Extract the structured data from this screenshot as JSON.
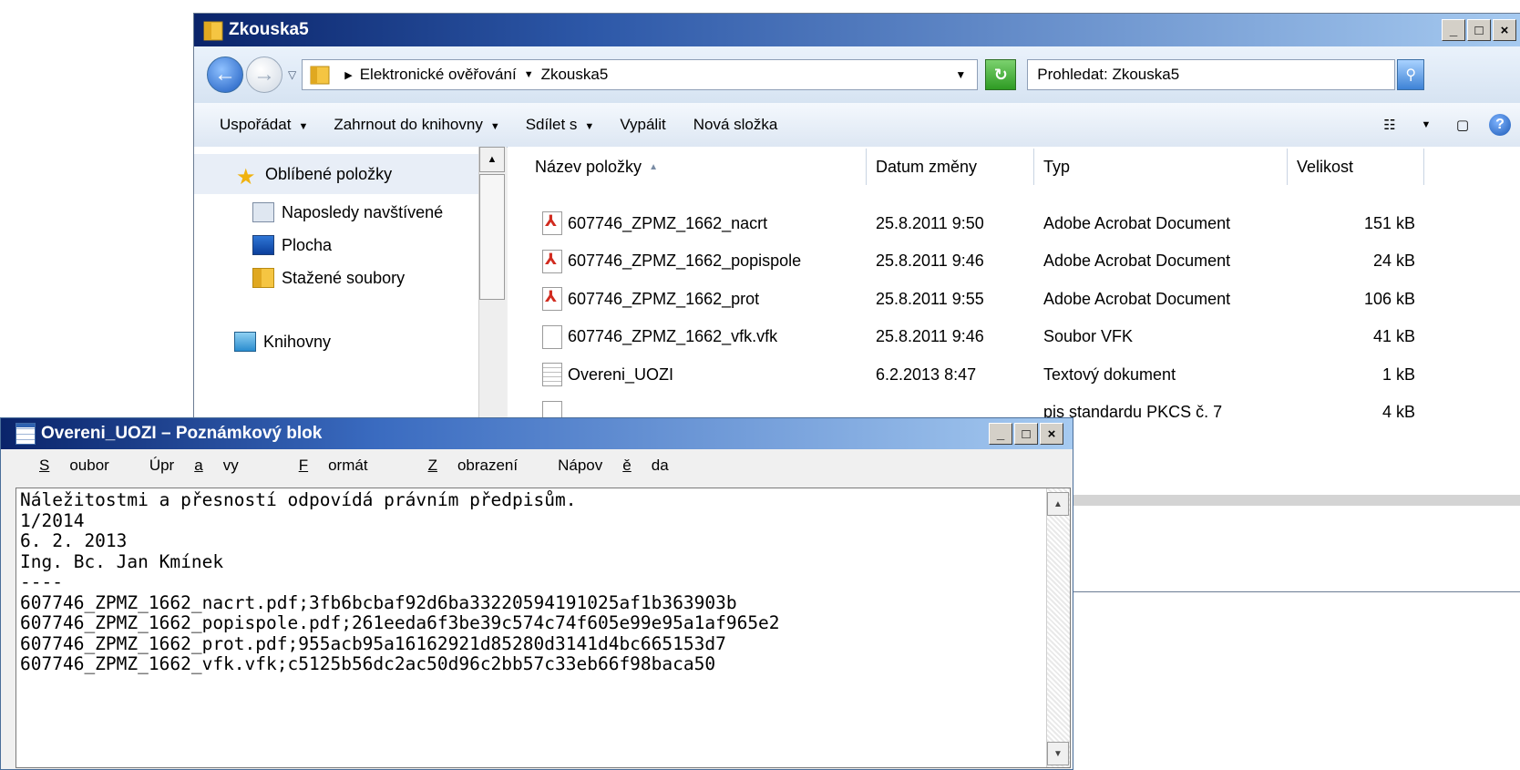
{
  "explorer": {
    "title": "Zkouska5",
    "breadcrumb": [
      "Elektronické ověřování",
      "Zkouska5"
    ],
    "search_placeholder": "Prohledat: Zkouska5",
    "toolbar": {
      "organize": "Uspořádat",
      "include_in_library": "Zahrnout do knihovny",
      "share": "Sdílet s",
      "burn": "Vypálit",
      "new_folder": "Nová složka"
    },
    "nav": {
      "favorites": "Oblíbené položky",
      "recent": "Naposledy navštívené",
      "desktop": "Plocha",
      "downloads": "Stažené soubory",
      "libraries": "Knihovny"
    },
    "columns": {
      "name": "Název položky",
      "date": "Datum změny",
      "type": "Typ",
      "size": "Velikost"
    },
    "files": [
      {
        "name": "607746_ZPMZ_1662_nacrt",
        "date": "25.8.2011 9:50",
        "type": "Adobe Acrobat Document",
        "size": "151 kB",
        "icon": "pdf"
      },
      {
        "name": "607746_ZPMZ_1662_popispole",
        "date": "25.8.2011 9:46",
        "type": "Adobe Acrobat Document",
        "size": "24 kB",
        "icon": "pdf"
      },
      {
        "name": "607746_ZPMZ_1662_prot",
        "date": "25.8.2011 9:55",
        "type": "Adobe Acrobat Document",
        "size": "106 kB",
        "icon": "pdf"
      },
      {
        "name": "607746_ZPMZ_1662_vfk.vfk",
        "date": "25.8.2011 9:46",
        "type": "Soubor VFK",
        "size": "41 kB",
        "icon": "file"
      },
      {
        "name": "Overeni_UOZI",
        "date": "6.2.2013 8:47",
        "type": "Textový dokument",
        "size": "1 kB",
        "icon": "txt"
      },
      {
        "name": "",
        "date": "",
        "type": "pis standardu PKCS č. 7",
        "size": "4 kB",
        "icon": "file"
      }
    ]
  },
  "notepad": {
    "title": "Overeni_UOZI – Poznámkový blok",
    "menu": {
      "file_pre": "",
      "file_key": "S",
      "file_post": "oubor",
      "edit_pre": "Úpr",
      "edit_key": "a",
      "edit_post": "vy",
      "format_pre": "",
      "format_key": "F",
      "format_post": "ormát",
      "view_pre": "",
      "view_key": "Z",
      "view_post": "obrazení",
      "help_pre": "Nápov",
      "help_key": "ě",
      "help_post": "da"
    },
    "content": "Náležitostmi a přesností odpovídá právním předpisům.\n1/2014\n6. 2. 2013\nIng. Bc. Jan Kmínek\n----\n607746_ZPMZ_1662_nacrt.pdf;3fb6bcbaf92d6ba33220594191025af1b363903b\n607746_ZPMZ_1662_popispole.pdf;261eeda6f3be39c574c74f605e99e95a1af965e2\n607746_ZPMZ_1662_prot.pdf;955acb95a16162921d85280d3141d4bc665153d7\n607746_ZPMZ_1662_vfk.vfk;c5125b56dc2ac50d96c2bb57c33eb66f98baca50"
  }
}
